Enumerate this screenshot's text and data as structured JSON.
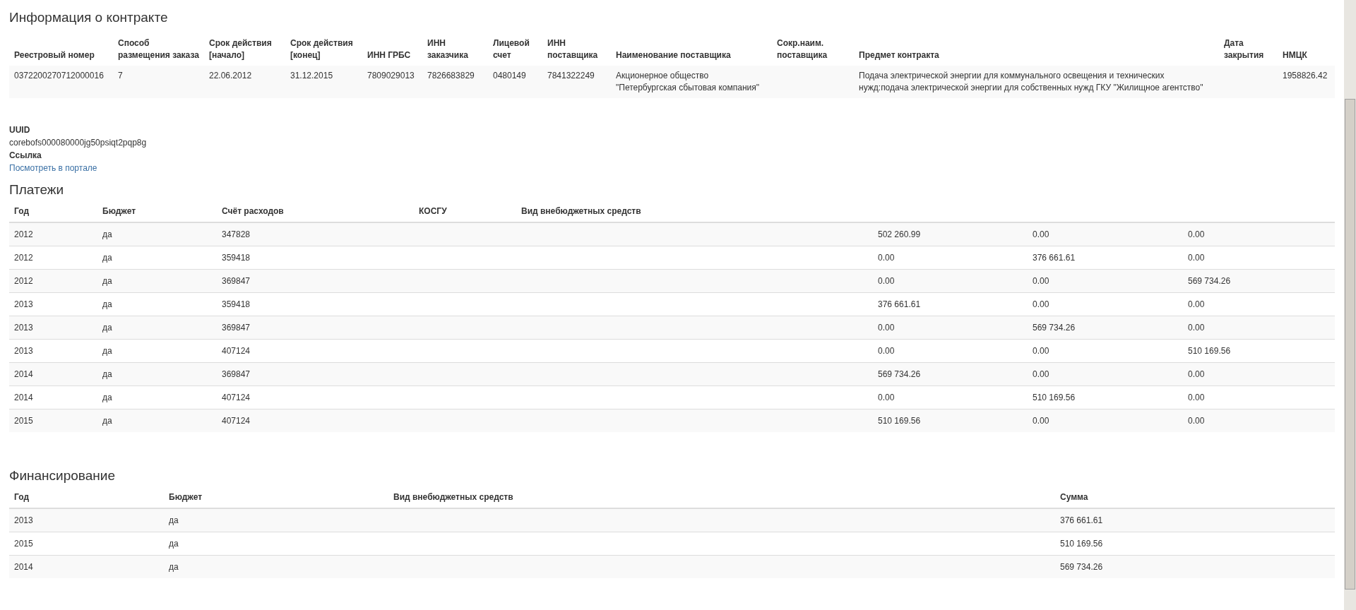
{
  "contract_info": {
    "title": "Информация о контракте",
    "columns": [
      "Реестровый номер",
      "Способ\nразмещения заказа",
      "Срок действия\n[начало]",
      "Срок действия\n[конец]",
      "ИНН ГРБС",
      "ИНН\nзаказчика",
      "Лицевой\nсчет",
      "ИНН\nпоставщика",
      "Наименование поставщика",
      "Сокр.наим.\nпоставщика",
      "Предмет контракта",
      "Дата\nзакрытия",
      "НМЦК"
    ],
    "rows": [
      [
        "0372200270712000016",
        "7",
        "22.06.2012",
        "31.12.2015",
        "7809029013",
        "7826683829",
        "0480149",
        "7841322249",
        "Акционерное общество\n\"Петербургская сбытовая компания\"",
        "",
        "Подача электрической энергии для коммунального освещения и технических\nнужд:подача электрической энергии для собственных нужд ГКУ \"Жилищное агентство\"",
        "",
        "1958826.42"
      ]
    ]
  },
  "uuid": {
    "label": "UUID",
    "value": "corebofs000080000jg50psiqt2pqp8g"
  },
  "link": {
    "label": "Ссылка",
    "text": "Посмотреть в портале"
  },
  "payments": {
    "title": "Платежи",
    "columns": [
      "Год",
      "Бюджет",
      "Счёт расходов",
      "КОСГУ",
      "Вид внебюджетных средств"
    ],
    "rows": [
      [
        "2012",
        "да",
        "347828",
        "",
        "",
        "502 260.99",
        "0.00",
        "0.00"
      ],
      [
        "2012",
        "да",
        "359418",
        "",
        "",
        "0.00",
        "376 661.61",
        "0.00"
      ],
      [
        "2012",
        "да",
        "369847",
        "",
        "",
        "0.00",
        "0.00",
        "569 734.26"
      ],
      [
        "2013",
        "да",
        "359418",
        "",
        "",
        "376 661.61",
        "0.00",
        "0.00"
      ],
      [
        "2013",
        "да",
        "369847",
        "",
        "",
        "0.00",
        "569 734.26",
        "0.00"
      ],
      [
        "2013",
        "да",
        "407124",
        "",
        "",
        "0.00",
        "0.00",
        "510 169.56"
      ],
      [
        "2014",
        "да",
        "369847",
        "",
        "",
        "569 734.26",
        "0.00",
        "0.00"
      ],
      [
        "2014",
        "да",
        "407124",
        "",
        "",
        "0.00",
        "510 169.56",
        "0.00"
      ],
      [
        "2015",
        "да",
        "407124",
        "",
        "",
        "510 169.56",
        "0.00",
        "0.00"
      ]
    ]
  },
  "financing": {
    "title": "Финансирование",
    "columns": [
      "Год",
      "Бюджет",
      "Вид внебюджетных средств",
      "Сумма"
    ],
    "rows": [
      [
        "2013",
        "да",
        "",
        "376 661.61"
      ],
      [
        "2015",
        "да",
        "",
        "510 169.56"
      ],
      [
        "2014",
        "да",
        "",
        "569 734.26"
      ]
    ]
  }
}
